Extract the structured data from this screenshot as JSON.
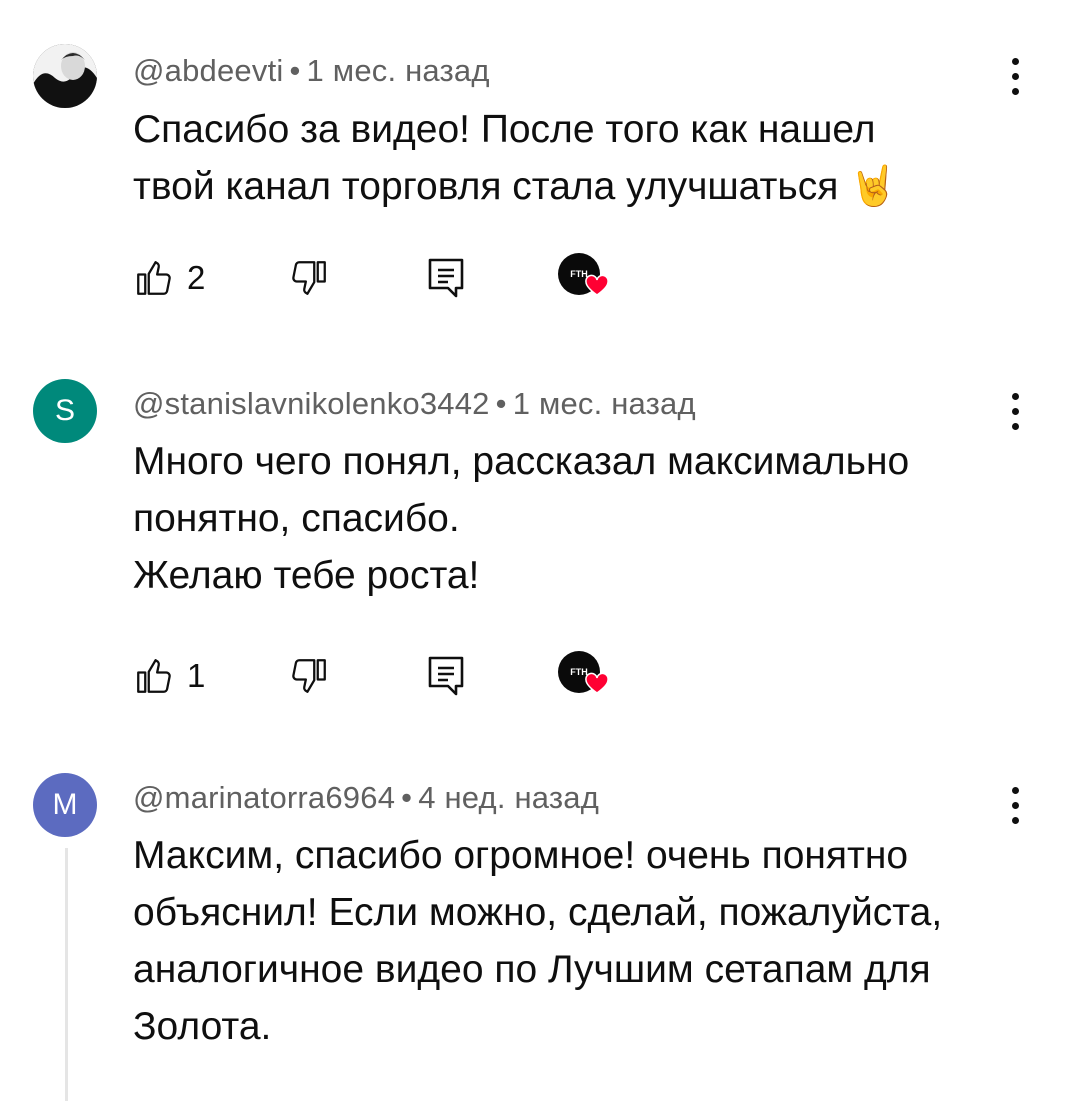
{
  "comments": [
    {
      "author": "@abdeevti",
      "time": "1 мес. назад",
      "lines": [
        "Спасибо за видео! После того как нашел",
        "твой канал торговля стала улучшаться 🤘"
      ],
      "likes": "2",
      "avatar": {
        "type": "photo",
        "letter": ""
      }
    },
    {
      "author": "@stanislavnikolenko3442",
      "time": "1 мес. назад",
      "lines": [
        "Много чего понял, рассказал максимально",
        "понятно, спасибо.",
        "Желаю тебе роста!"
      ],
      "likes": "1",
      "avatar": {
        "type": "letter",
        "letter": "S",
        "color": "#00897b"
      }
    },
    {
      "author": "@marinatorra6964",
      "time": "4 нед. назад",
      "lines": [
        "Максим, спасибо огромное! очень понятно",
        "объяснил! Если можно, сделай, пожалуйста,",
        "аналогичное видео по Лучшим сетапам для",
        "Золота."
      ],
      "avatar": {
        "type": "letter",
        "letter": "M",
        "color": "#5c6bc0"
      }
    }
  ],
  "separator": "•",
  "creator_heart": {
    "badge_text": "FTH",
    "heart_color": "#ff0033"
  },
  "icons": [
    "like-icon",
    "dislike-icon",
    "reply-icon",
    "creator-heart-icon",
    "more-vert-icon"
  ]
}
